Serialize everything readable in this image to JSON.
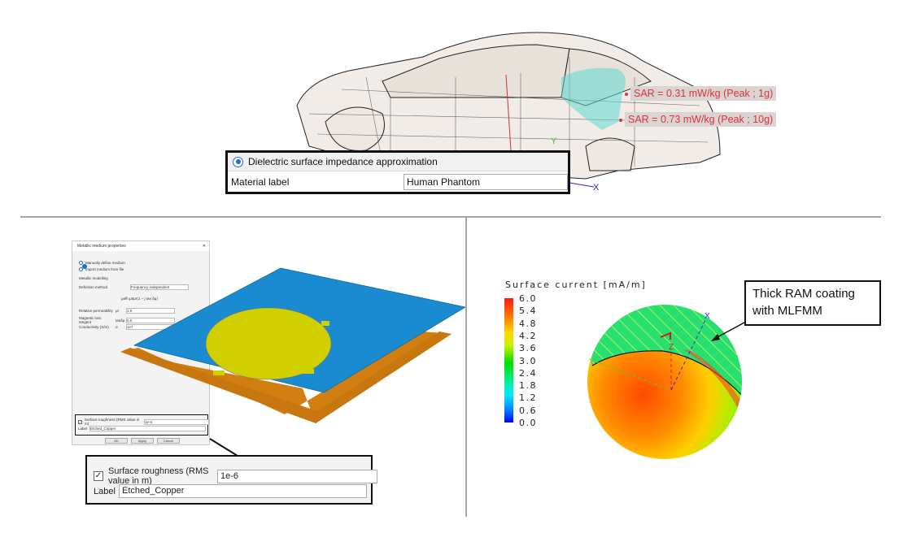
{
  "car_panel": {
    "sar_labels": [
      "SAR = 0.31 mW/kg (Peak ; 1g)",
      "SAR = 0.73 mW/kg (Peak ; 10g)"
    ],
    "axis_labels": {
      "y": "Y",
      "x": "X"
    },
    "dialog": {
      "option": "Dielectric surface impedance approximation",
      "material_label": "Material label",
      "material_value": "Human Phantom"
    }
  },
  "metal_panel": {
    "dialog": {
      "title": "Metallic medium properties",
      "options": [
        "Manually define medium",
        "Import medium from file"
      ],
      "section": "Metallic modelling",
      "definition_method_label": "Definition method",
      "definition_method_value": "Frequency independent",
      "formula": "μeff=μ0μr(1 − j tan δμ)",
      "fields": [
        {
          "label": "Relative permeability",
          "symbol": "μr",
          "value": "1.0"
        },
        {
          "label": "Magnetic loss tangent",
          "symbol": "tanδμ",
          "value": "0.0"
        },
        {
          "label": "Conductivity (S/m)",
          "symbol": "σ",
          "value": "1e7"
        }
      ],
      "buttons": [
        "OK",
        "Apply",
        "Cancel"
      ]
    },
    "roughness": {
      "checked": true,
      "label": "Surface roughness (RMS value in m)",
      "value": "1e-6",
      "label_field": "Label",
      "label_value": "Etched_Copper"
    }
  },
  "current_panel": {
    "colorbar_title": "Surface current [mA/m]",
    "ticks": [
      "6.0",
      "5.4",
      "4.8",
      "4.2",
      "3.6",
      "3.0",
      "2.4",
      "1.8",
      "1.2",
      "0.6",
      "0.0"
    ],
    "axis_labels": {
      "x": "X",
      "y": "Y",
      "z": "Z"
    },
    "callout": [
      "Thick RAM coating",
      "with MLFMM"
    ]
  }
}
